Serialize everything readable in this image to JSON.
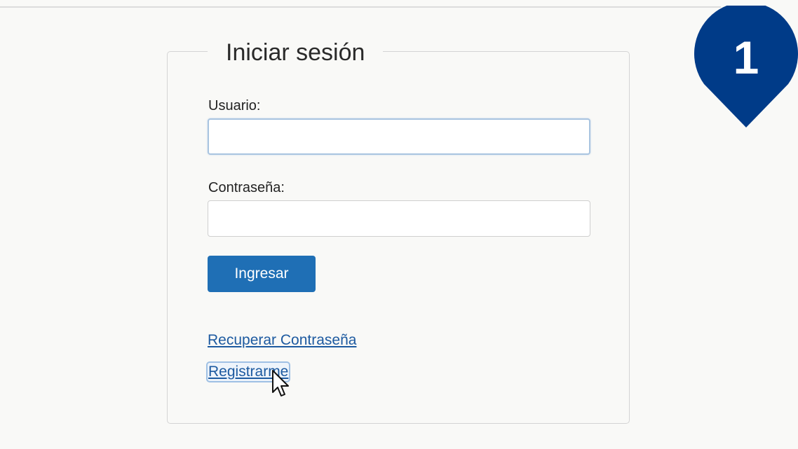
{
  "login": {
    "title": "Iniciar sesión",
    "username_label": "Usuario:",
    "username_value": "",
    "password_label": "Contraseña:",
    "password_value": "",
    "submit_label": "Ingresar",
    "recover_password_link": "Recuperar Contraseña",
    "register_link": "Registrarme"
  },
  "step_marker": {
    "number": "1",
    "color": "#003b88"
  },
  "colors": {
    "primary_button": "#1f6fb5",
    "link": "#1d5aa0",
    "background": "#f9f9f7"
  },
  "icons": [
    "step-marker-pin-icon",
    "mouse-pointer-icon"
  ]
}
